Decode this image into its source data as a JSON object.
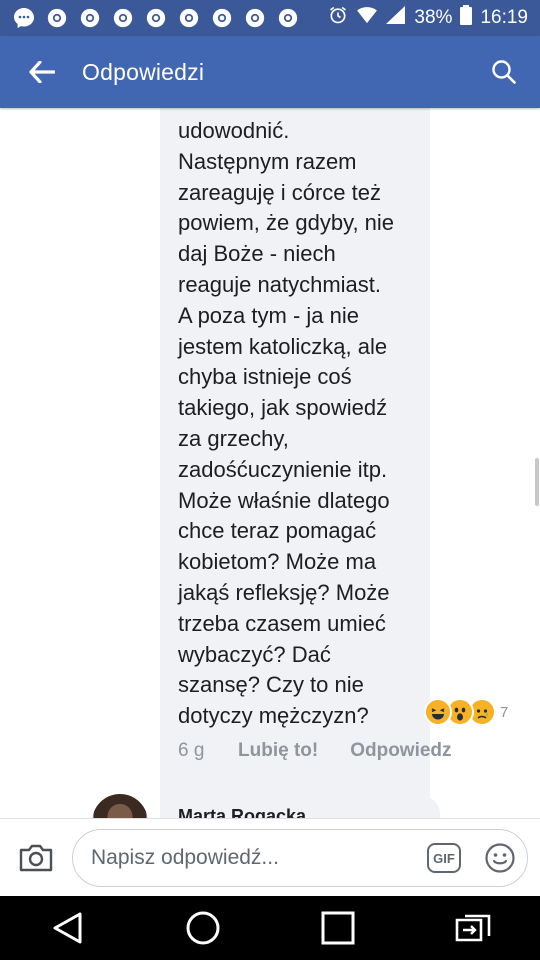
{
  "status_bar": {
    "battery": "38%",
    "time": "16:19",
    "notification_icons": [
      "messenger-icon",
      "chrome-icon",
      "chrome-icon",
      "chrome-icon",
      "chrome-icon",
      "chrome-icon",
      "chrome-icon",
      "chrome-icon",
      "chrome-icon"
    ]
  },
  "header": {
    "title": "Odpowiedzi"
  },
  "comment": {
    "lines": [
      "udowodnić.",
      "Następnym razem",
      "zareaguję i córce też",
      "powiem, że gdyby, nie",
      "daj Boże - niech",
      "reaguje natychmiast.",
      "A poza tym - ja nie",
      "jestem katoliczką, ale",
      "chyba istnieje coś",
      "takiego, jak spowiedź",
      "za grzechy,",
      "zadośćuczynienie itp.",
      "Może właśnie dlatego",
      "chce teraz pomagać",
      "kobietom? Może ma",
      "jakąś refleksję? Może",
      "trzeba czasem umieć",
      "wybaczyć? Dać",
      "szansę? Czy to nie",
      "dotyczy mężczyzn?"
    ],
    "reactions": [
      "haha-icon",
      "wow-icon",
      "sad-icon"
    ],
    "reaction_count": "7",
    "time": "6 g",
    "like_label": "Lubię to!",
    "reply_label": "Odpowiedz"
  },
  "next_reply": {
    "author": "Marta Rogacka"
  },
  "composer": {
    "placeholder": "Napisz odpowiedź...",
    "gif_label": "GIF"
  },
  "colors": {
    "status_bar": "#3b5998",
    "app_bar": "#4267b2",
    "bubble": "#f0f2f5",
    "meta_text": "#90949c"
  }
}
